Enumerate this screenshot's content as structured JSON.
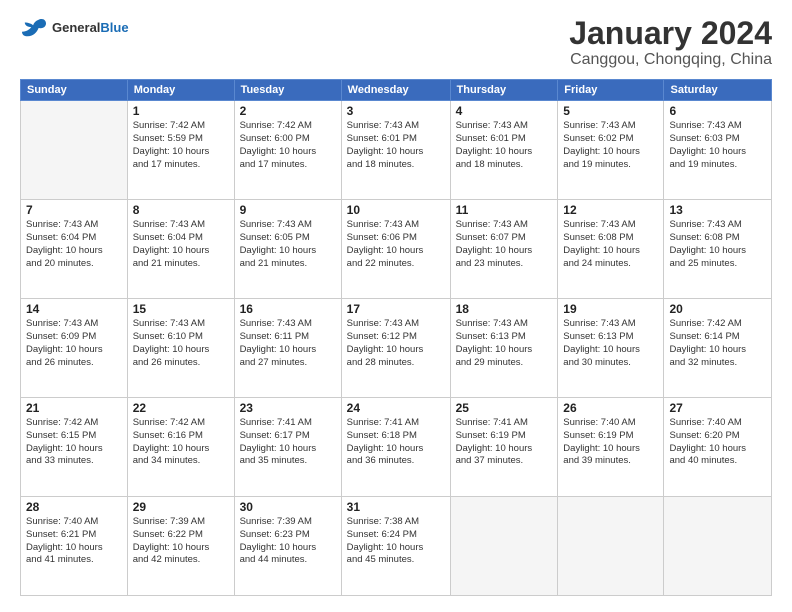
{
  "logo": {
    "text_general": "General",
    "text_blue": "Blue"
  },
  "header": {
    "month": "January 2024",
    "location": "Canggou, Chongqing, China"
  },
  "days_of_week": [
    "Sunday",
    "Monday",
    "Tuesday",
    "Wednesday",
    "Thursday",
    "Friday",
    "Saturday"
  ],
  "weeks": [
    [
      {
        "day": "",
        "info": ""
      },
      {
        "day": "1",
        "info": "Sunrise: 7:42 AM\nSunset: 5:59 PM\nDaylight: 10 hours\nand 17 minutes."
      },
      {
        "day": "2",
        "info": "Sunrise: 7:42 AM\nSunset: 6:00 PM\nDaylight: 10 hours\nand 17 minutes."
      },
      {
        "day": "3",
        "info": "Sunrise: 7:43 AM\nSunset: 6:01 PM\nDaylight: 10 hours\nand 18 minutes."
      },
      {
        "day": "4",
        "info": "Sunrise: 7:43 AM\nSunset: 6:01 PM\nDaylight: 10 hours\nand 18 minutes."
      },
      {
        "day": "5",
        "info": "Sunrise: 7:43 AM\nSunset: 6:02 PM\nDaylight: 10 hours\nand 19 minutes."
      },
      {
        "day": "6",
        "info": "Sunrise: 7:43 AM\nSunset: 6:03 PM\nDaylight: 10 hours\nand 19 minutes."
      }
    ],
    [
      {
        "day": "7",
        "info": "Sunrise: 7:43 AM\nSunset: 6:04 PM\nDaylight: 10 hours\nand 20 minutes."
      },
      {
        "day": "8",
        "info": "Sunrise: 7:43 AM\nSunset: 6:04 PM\nDaylight: 10 hours\nand 21 minutes."
      },
      {
        "day": "9",
        "info": "Sunrise: 7:43 AM\nSunset: 6:05 PM\nDaylight: 10 hours\nand 21 minutes."
      },
      {
        "day": "10",
        "info": "Sunrise: 7:43 AM\nSunset: 6:06 PM\nDaylight: 10 hours\nand 22 minutes."
      },
      {
        "day": "11",
        "info": "Sunrise: 7:43 AM\nSunset: 6:07 PM\nDaylight: 10 hours\nand 23 minutes."
      },
      {
        "day": "12",
        "info": "Sunrise: 7:43 AM\nSunset: 6:08 PM\nDaylight: 10 hours\nand 24 minutes."
      },
      {
        "day": "13",
        "info": "Sunrise: 7:43 AM\nSunset: 6:08 PM\nDaylight: 10 hours\nand 25 minutes."
      }
    ],
    [
      {
        "day": "14",
        "info": "Sunrise: 7:43 AM\nSunset: 6:09 PM\nDaylight: 10 hours\nand 26 minutes."
      },
      {
        "day": "15",
        "info": "Sunrise: 7:43 AM\nSunset: 6:10 PM\nDaylight: 10 hours\nand 26 minutes."
      },
      {
        "day": "16",
        "info": "Sunrise: 7:43 AM\nSunset: 6:11 PM\nDaylight: 10 hours\nand 27 minutes."
      },
      {
        "day": "17",
        "info": "Sunrise: 7:43 AM\nSunset: 6:12 PM\nDaylight: 10 hours\nand 28 minutes."
      },
      {
        "day": "18",
        "info": "Sunrise: 7:43 AM\nSunset: 6:13 PM\nDaylight: 10 hours\nand 29 minutes."
      },
      {
        "day": "19",
        "info": "Sunrise: 7:43 AM\nSunset: 6:13 PM\nDaylight: 10 hours\nand 30 minutes."
      },
      {
        "day": "20",
        "info": "Sunrise: 7:42 AM\nSunset: 6:14 PM\nDaylight: 10 hours\nand 32 minutes."
      }
    ],
    [
      {
        "day": "21",
        "info": "Sunrise: 7:42 AM\nSunset: 6:15 PM\nDaylight: 10 hours\nand 33 minutes."
      },
      {
        "day": "22",
        "info": "Sunrise: 7:42 AM\nSunset: 6:16 PM\nDaylight: 10 hours\nand 34 minutes."
      },
      {
        "day": "23",
        "info": "Sunrise: 7:41 AM\nSunset: 6:17 PM\nDaylight: 10 hours\nand 35 minutes."
      },
      {
        "day": "24",
        "info": "Sunrise: 7:41 AM\nSunset: 6:18 PM\nDaylight: 10 hours\nand 36 minutes."
      },
      {
        "day": "25",
        "info": "Sunrise: 7:41 AM\nSunset: 6:19 PM\nDaylight: 10 hours\nand 37 minutes."
      },
      {
        "day": "26",
        "info": "Sunrise: 7:40 AM\nSunset: 6:19 PM\nDaylight: 10 hours\nand 39 minutes."
      },
      {
        "day": "27",
        "info": "Sunrise: 7:40 AM\nSunset: 6:20 PM\nDaylight: 10 hours\nand 40 minutes."
      }
    ],
    [
      {
        "day": "28",
        "info": "Sunrise: 7:40 AM\nSunset: 6:21 PM\nDaylight: 10 hours\nand 41 minutes."
      },
      {
        "day": "29",
        "info": "Sunrise: 7:39 AM\nSunset: 6:22 PM\nDaylight: 10 hours\nand 42 minutes."
      },
      {
        "day": "30",
        "info": "Sunrise: 7:39 AM\nSunset: 6:23 PM\nDaylight: 10 hours\nand 44 minutes."
      },
      {
        "day": "31",
        "info": "Sunrise: 7:38 AM\nSunset: 6:24 PM\nDaylight: 10 hours\nand 45 minutes."
      },
      {
        "day": "",
        "info": ""
      },
      {
        "day": "",
        "info": ""
      },
      {
        "day": "",
        "info": ""
      }
    ]
  ]
}
